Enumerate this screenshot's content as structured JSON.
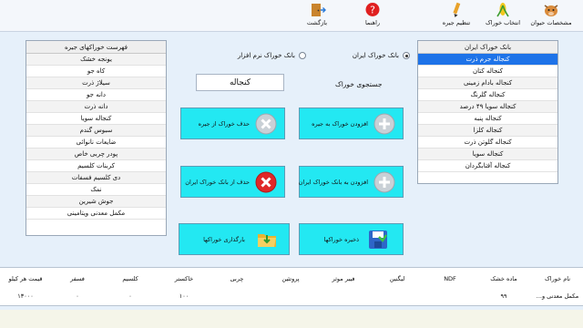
{
  "toolbar": {
    "animal_specs": "مشخصات حیوان",
    "feed_select": "انتخاب خوراک",
    "ration": "تنظیم جیره",
    "help": "راهنما",
    "back": "بازگشت"
  },
  "bank_list": {
    "header": "بانک خوراک ایران",
    "items": [
      "کنجاله جرم ذرت",
      "کنجاله کتان",
      "کنجاله بادام زمینی",
      "کنجاله گلرنگ",
      "کنجاله سویا ۴۹ درصد",
      "کنجاله پنبه",
      "کنجاله کلزا",
      "کنجاله گلوتن ذرت",
      "کنجاله سویا",
      "کنجاله آفتابگردان"
    ],
    "selected_index": 0
  },
  "ration_list": {
    "header": "فهرست خوراکهای جیره",
    "items": [
      "یونجه خشک",
      "کاه جو",
      "سیلاژ ذرت",
      "دانه جو",
      "دانه ذرت",
      "کنجاله سویا",
      "سبوس گندم",
      "ضایعات نانوائی",
      "پودر چربی خاص",
      "کربنات کلسیم",
      "دی کلسیم فسفات",
      "نمک",
      "جوش شیرین",
      "مکمل معدنی ویتامینی"
    ]
  },
  "source": {
    "iran_bank": "بانک خوراک ایران",
    "software_bank": "بانک خوراک نرم افزار",
    "selected": "iran"
  },
  "search": {
    "label": "جستجوی خوراک",
    "value": "کنجاله"
  },
  "actions": {
    "add_to_ration": "افزودن خوراک به جیره",
    "remove_from_ration": "حذف خوراک از جیره",
    "add_to_bank": "افزودن به بانک خوراک ایران",
    "remove_from_bank": "حذف از بانک خوراک ایران",
    "save_feeds": "ذخیره خوراکها",
    "load_feeds": "بارگذاری خوراکها"
  },
  "table": {
    "columns": [
      "نام خوراک",
      "ماده خشک",
      "NDF",
      "لیگنین",
      "فیبر موثر",
      "پروتئین",
      "چربی",
      "خاکستر",
      "کلسیم",
      "فسفر",
      "قیمت هر کیلو"
    ],
    "row": [
      "مکمل معدنی و...",
      "۹۹",
      "",
      "",
      "",
      "",
      "",
      "۱۰۰",
      "۰",
      "۰",
      "۱۳۰۰۰"
    ]
  },
  "colors": {
    "button_fill": "#23e8f2",
    "selection": "#1e73e8",
    "window_bg": "#e6f0fa"
  }
}
